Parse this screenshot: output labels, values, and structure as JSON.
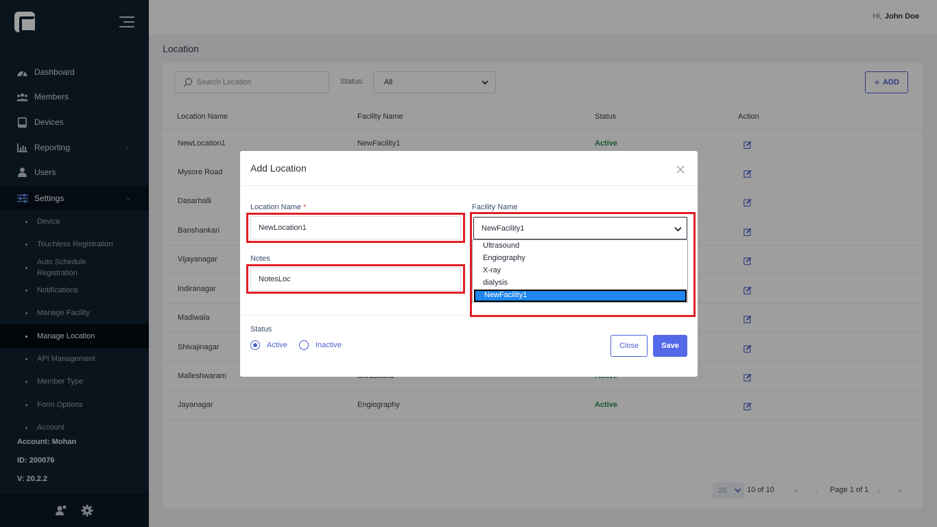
{
  "sidebar": {
    "nav": [
      {
        "label": "Dashboard",
        "icon": "dashboard-icon"
      },
      {
        "label": "Members",
        "icon": "members-icon"
      },
      {
        "label": "Devices",
        "icon": "devices-icon"
      },
      {
        "label": "Reporting",
        "icon": "reporting-icon"
      },
      {
        "label": "Users",
        "icon": "users-icon"
      },
      {
        "label": "Settings",
        "icon": "settings-sliders-icon"
      }
    ],
    "settings_sub": [
      "Device",
      "Touchless Registration",
      "Auto Schedule Registration",
      "Notifications",
      "Manage Facility",
      "Manage Location",
      "API Management",
      "Member Type",
      "Form Options",
      "Account"
    ],
    "account": "Account: Mohan",
    "id": "ID: 200076",
    "version": "V: 20.2.2"
  },
  "topbar": {
    "hi": "Hi,",
    "user": "John Doe"
  },
  "page": {
    "title": "Location",
    "search_placeholder": "Search Location",
    "status_label": "Status:",
    "status_value": "All",
    "add_label": "ADD"
  },
  "table": {
    "headers": [
      "Location Name",
      "Facility Name",
      "Status",
      "Action"
    ],
    "rows": [
      {
        "location": "NewLocation1",
        "facility": "NewFacility1",
        "status": "Active"
      },
      {
        "location": "Mysore Road",
        "facility": "",
        "status": ""
      },
      {
        "location": "Dasarhalli",
        "facility": "",
        "status": ""
      },
      {
        "location": "Banshankari",
        "facility": "",
        "status": ""
      },
      {
        "location": "Vijayanagar",
        "facility": "",
        "status": ""
      },
      {
        "location": "Indiranagar",
        "facility": "",
        "status": ""
      },
      {
        "location": "Madiwala",
        "facility": "",
        "status": ""
      },
      {
        "location": "Shivajinagar",
        "facility": "",
        "status": ""
      },
      {
        "location": "Malleshwaram",
        "facility": "Ultrasound",
        "status": "Active"
      },
      {
        "location": "Jayanagar",
        "facility": "Engiography",
        "status": "Active"
      }
    ]
  },
  "pagination": {
    "page_size": "20",
    "count": "10 of 10",
    "page": "Page 1 of 1"
  },
  "modal": {
    "title": "Add Location",
    "location_label": "Location Name",
    "required_mark": "*",
    "location_value": "NewLocation1",
    "notes_label": "Notes",
    "notes_value": "NotesLoc",
    "facility_label": "Facility Name",
    "facility_value": "NewFacility1",
    "facility_options": [
      "Ultrasound",
      "Engiography",
      "X-ray",
      "dialysis",
      "NewFacility1"
    ],
    "status_label": "Status",
    "status_options": [
      "Active",
      "Inactive"
    ],
    "close_label": "Close",
    "save_label": "Save"
  },
  "colors": {
    "accent": "#4b5fd1",
    "sidebar": "#0f2130",
    "active_status": "#2a8f4f",
    "highlight": "#e01e26"
  }
}
